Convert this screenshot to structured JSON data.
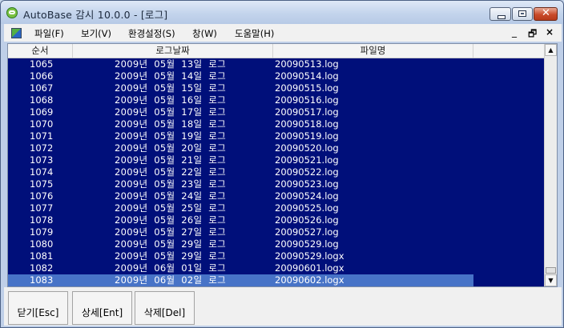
{
  "window": {
    "title": "AutoBase 감시 10.0.0 - [로그]"
  },
  "menubar": {
    "items": [
      "파일(F)",
      "보기(V)",
      "환경설정(S)",
      "창(W)",
      "도움말(H)"
    ]
  },
  "mdi_controls": {
    "minimize": "_",
    "restore": "🗗",
    "close": "×"
  },
  "table": {
    "columns": [
      "순서",
      "로그날짜",
      "파일명"
    ],
    "rows": [
      [
        "1065",
        "2009년  05월  13일  로그",
        "20090513.log"
      ],
      [
        "1066",
        "2009년  05월  14일  로그",
        "20090514.log"
      ],
      [
        "1067",
        "2009년  05월  15일  로그",
        "20090515.log"
      ],
      [
        "1068",
        "2009년  05월  16일  로그",
        "20090516.log"
      ],
      [
        "1069",
        "2009년  05월  17일  로그",
        "20090517.log"
      ],
      [
        "1070",
        "2009년  05월  18일  로그",
        "20090518.log"
      ],
      [
        "1071",
        "2009년  05월  19일  로그",
        "20090519.log"
      ],
      [
        "1072",
        "2009년  05월  20일  로그",
        "20090520.log"
      ],
      [
        "1073",
        "2009년  05월  21일  로그",
        "20090521.log"
      ],
      [
        "1074",
        "2009년  05월  22일  로그",
        "20090522.log"
      ],
      [
        "1075",
        "2009년  05월  23일  로그",
        "20090523.log"
      ],
      [
        "1076",
        "2009년  05월  24일  로그",
        "20090524.log"
      ],
      [
        "1077",
        "2009년  05월  25일  로그",
        "20090525.log"
      ],
      [
        "1078",
        "2009년  05월  26일  로그",
        "20090526.log"
      ],
      [
        "1079",
        "2009년  05월  27일  로그",
        "20090527.log"
      ],
      [
        "1080",
        "2009년  05월  29일  로그",
        "20090529.log"
      ],
      [
        "1081",
        "2009년  05월  29일  로그",
        "20090529.logx"
      ],
      [
        "1082",
        "2009년  06월  01일  로그",
        "20090601.logx"
      ],
      [
        "1083",
        "2009년  06월  02일  로그",
        "20090602.logx"
      ]
    ],
    "selected_row": 18
  },
  "buttons": {
    "close": "닫기[Esc]",
    "detail": "상세[Ent]",
    "delete": "삭제[Del]"
  },
  "icons": {
    "app": "autobase-icon",
    "scroll_up": "▲",
    "scroll_down": "▼"
  },
  "colors": {
    "list_bg": "#000f7a",
    "selection": "#4773c7",
    "row_text": "#ffffff"
  }
}
